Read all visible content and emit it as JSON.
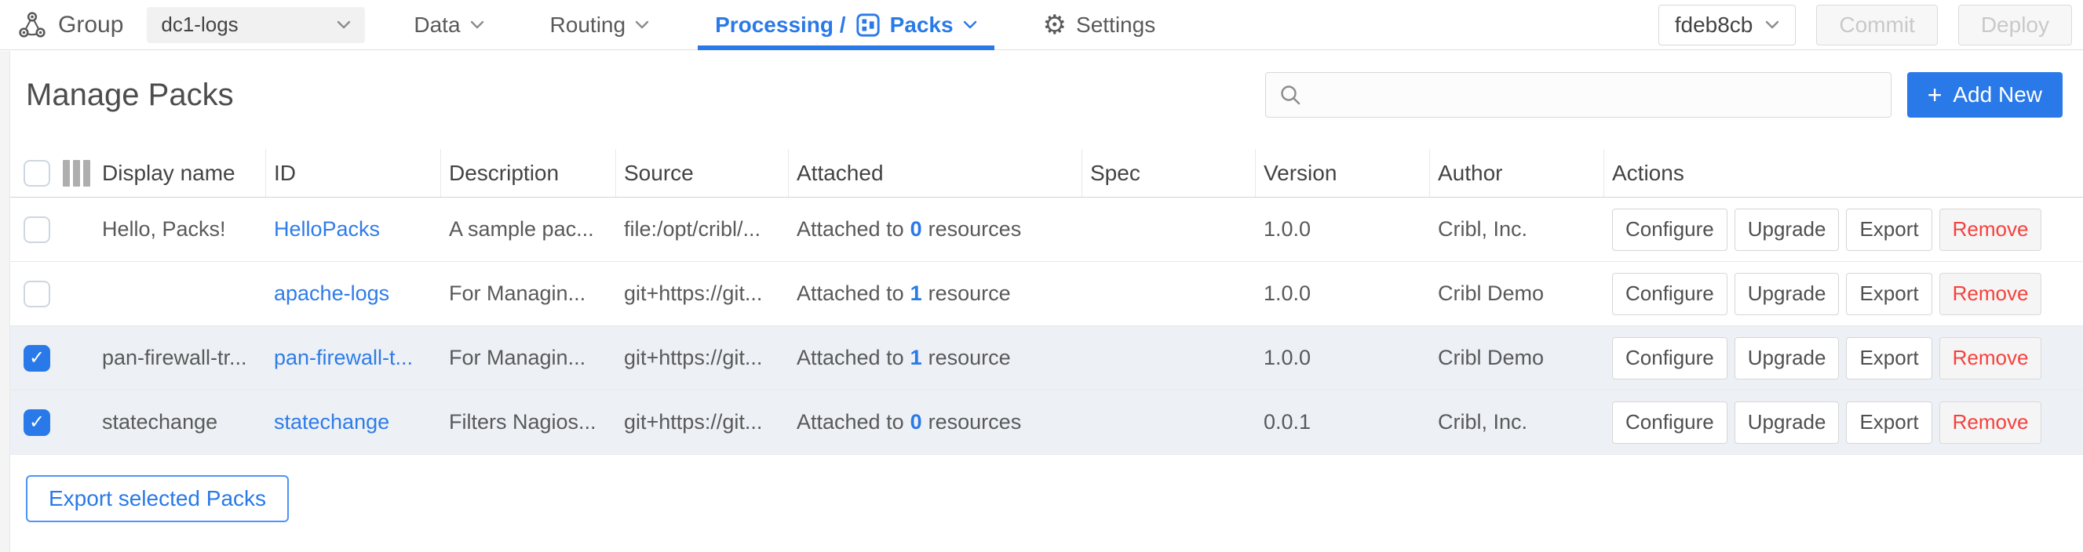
{
  "topbar": {
    "group_label": "Group",
    "group_select": {
      "value": "dc1-logs"
    },
    "tabs": [
      {
        "label": "Data"
      },
      {
        "label": "Routing"
      },
      {
        "label_prefix": "Processing /",
        "label_suffix": "Packs",
        "active": true
      }
    ],
    "settings_label": "Settings",
    "version_select": {
      "value": "fdeb8cb"
    },
    "commit_label": "Commit",
    "deploy_label": "Deploy"
  },
  "page": {
    "title": "Manage Packs",
    "search_placeholder": "",
    "add_new": {
      "icon": "+",
      "label": "Add New"
    }
  },
  "table": {
    "columns": {
      "display_name": "Display name",
      "id": "ID",
      "description": "Description",
      "source": "Source",
      "attached": "Attached",
      "spec": "Spec",
      "version": "Version",
      "author": "Author",
      "actions": "Actions"
    },
    "action_labels": [
      "Configure",
      "Upgrade",
      "Export",
      "Remove"
    ],
    "rows": [
      {
        "selected": false,
        "display_name": "Hello, Packs!",
        "id": "HelloPacks",
        "description": "A sample pac...",
        "source": "file:/opt/cribl/...",
        "attached": {
          "before": "Attached to",
          "count": "0",
          "after": "resources"
        },
        "spec": "",
        "version": "1.0.0",
        "author": "Cribl, Inc."
      },
      {
        "selected": false,
        "display_name": "",
        "id": "apache-logs",
        "description": "For Managin...",
        "source": "git+https://git...",
        "attached": {
          "before": "Attached to",
          "count": "1",
          "after": "resource"
        },
        "spec": "",
        "version": "1.0.0",
        "author": "Cribl Demo"
      },
      {
        "selected": true,
        "display_name": "pan-firewall-tr...",
        "id": "pan-firewall-t...",
        "description": "For Managin...",
        "source": "git+https://git...",
        "attached": {
          "before": "Attached to",
          "count": "1",
          "after": "resource"
        },
        "spec": "",
        "version": "1.0.0",
        "author": "Cribl Demo"
      },
      {
        "selected": true,
        "display_name": "statechange",
        "id": "statechange",
        "description": "Filters Nagios...",
        "source": "git+https://git...",
        "attached": {
          "before": "Attached to",
          "count": "0",
          "after": "resources"
        },
        "spec": "",
        "version": "0.0.1",
        "author": "Cribl, Inc."
      }
    ]
  },
  "footer": {
    "export_selected_label": "Export selected Packs"
  },
  "colors": {
    "accent_blue": "#2979e8",
    "link_blue": "#2e7ce8",
    "remove_red": "#f5413d",
    "selected_row_bg": "#edf1f5",
    "disabled_text": "#c9c9c9"
  }
}
